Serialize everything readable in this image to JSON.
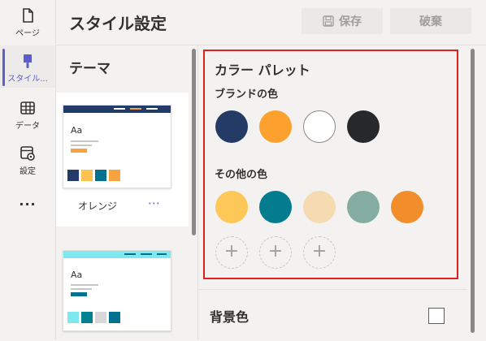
{
  "rail": {
    "items": [
      {
        "label": "ページ",
        "icon": "page-icon"
      },
      {
        "label": "スタイル...",
        "icon": "style-brush-icon"
      },
      {
        "label": "データ",
        "icon": "table-icon"
      },
      {
        "label": "設定",
        "icon": "settings-icon"
      },
      {
        "label": "...",
        "icon": "more-icon"
      }
    ]
  },
  "header": {
    "title": "スタイル設定",
    "save_label": "保存",
    "discard_label": "破棄"
  },
  "themes": {
    "title": "テーマ",
    "items": [
      {
        "name": "オレンジ",
        "more": "⋯",
        "text": "Aa",
        "accent": "#f7a440",
        "band": "#223b68",
        "swatches": [
          "#223b68",
          "#fdc352",
          "#00718f",
          "#f7a440"
        ]
      },
      {
        "name": "",
        "more": "",
        "text": "Aa",
        "accent": "#00718f",
        "band": "#7ee8ee",
        "swatches": [
          "#7ee8ee",
          "#00838f",
          "#d8d8d8",
          "#00718f"
        ]
      }
    ]
  },
  "palette": {
    "title": "カラー パレット",
    "brand_title": "ブランドの色",
    "brand_colors": [
      "#233b65",
      "#fca02e",
      "#ffffff",
      "#26282a"
    ],
    "other_title": "その他の色",
    "other_colors": [
      "#fdc858",
      "#037c90",
      "#f6dab1",
      "#84aca0",
      "#f18d2b"
    ],
    "add_symbol": "+"
  },
  "background": {
    "label": "背景色",
    "color": "#ffffff"
  }
}
